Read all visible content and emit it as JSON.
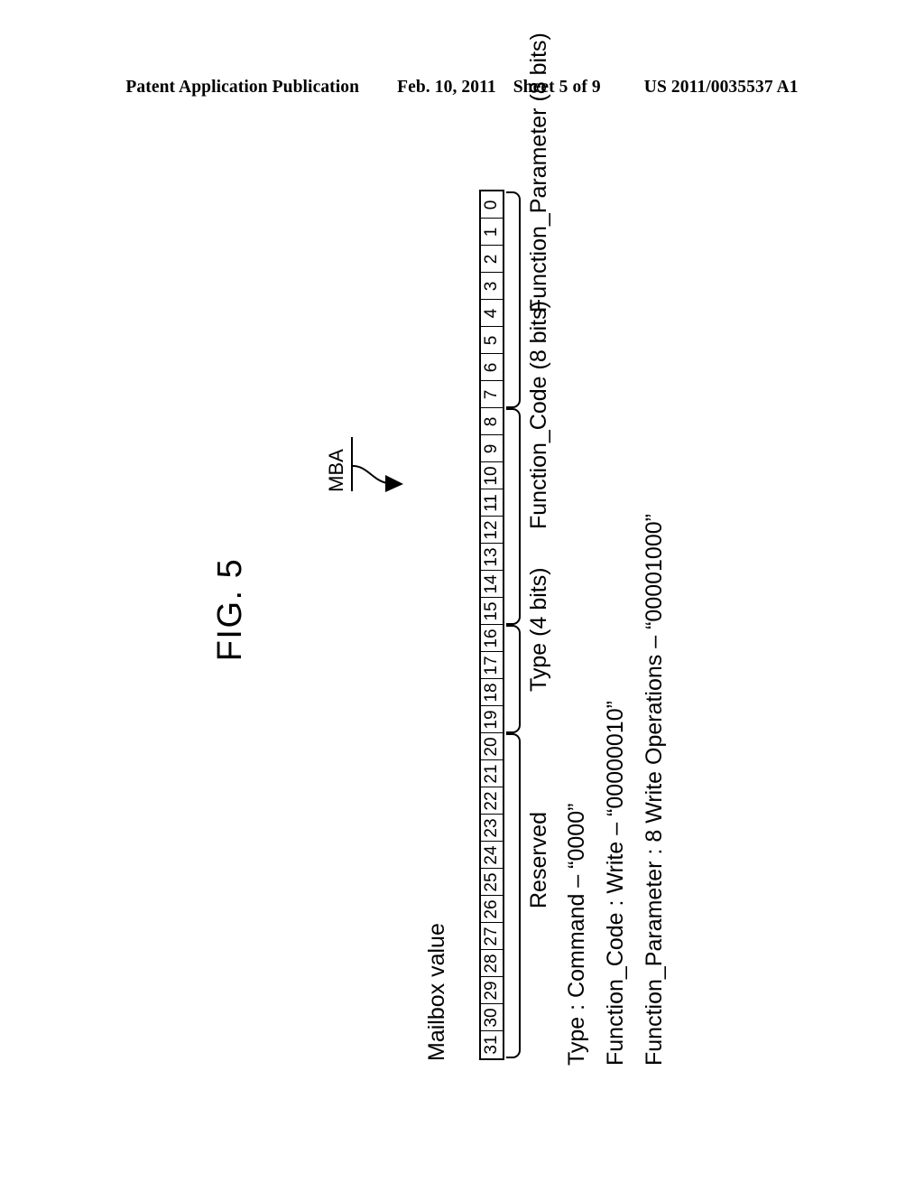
{
  "header": {
    "left": "Patent Application Publication",
    "date": "Feb. 10, 2011",
    "sheet": "Sheet 5 of 9",
    "patent_number": "US 2011/0035537 A1"
  },
  "figure": {
    "title": "FIG. 5",
    "pointer_label": "MBA",
    "register_caption": "Mailbox value",
    "bits": [
      "0",
      "1",
      "2",
      "3",
      "4",
      "5",
      "6",
      "7",
      "8",
      "9",
      "10",
      "11",
      "12",
      "13",
      "14",
      "15",
      "16",
      "17",
      "18",
      "19",
      "20",
      "21",
      "22",
      "23",
      "24",
      "25",
      "26",
      "27",
      "28",
      "29",
      "30",
      "31"
    ],
    "fields": [
      {
        "label": "Function_Parameter (8 bits)",
        "bit_high": 7,
        "bit_low": 0
      },
      {
        "label": "Function_Code (8 bits)",
        "bit_high": 15,
        "bit_low": 8
      },
      {
        "label": "Type (4 bits)",
        "bit_high": 19,
        "bit_low": 16
      },
      {
        "label": "Reserved",
        "bit_high": 31,
        "bit_low": 20
      }
    ],
    "descriptions": [
      "Type  : Command – “0000”",
      "Function_Code : Write – “00000010”",
      "Function_Parameter : 8 Write Operations – “00001000”"
    ]
  },
  "colors": {
    "ink": "#000000",
    "page": "#ffffff"
  }
}
